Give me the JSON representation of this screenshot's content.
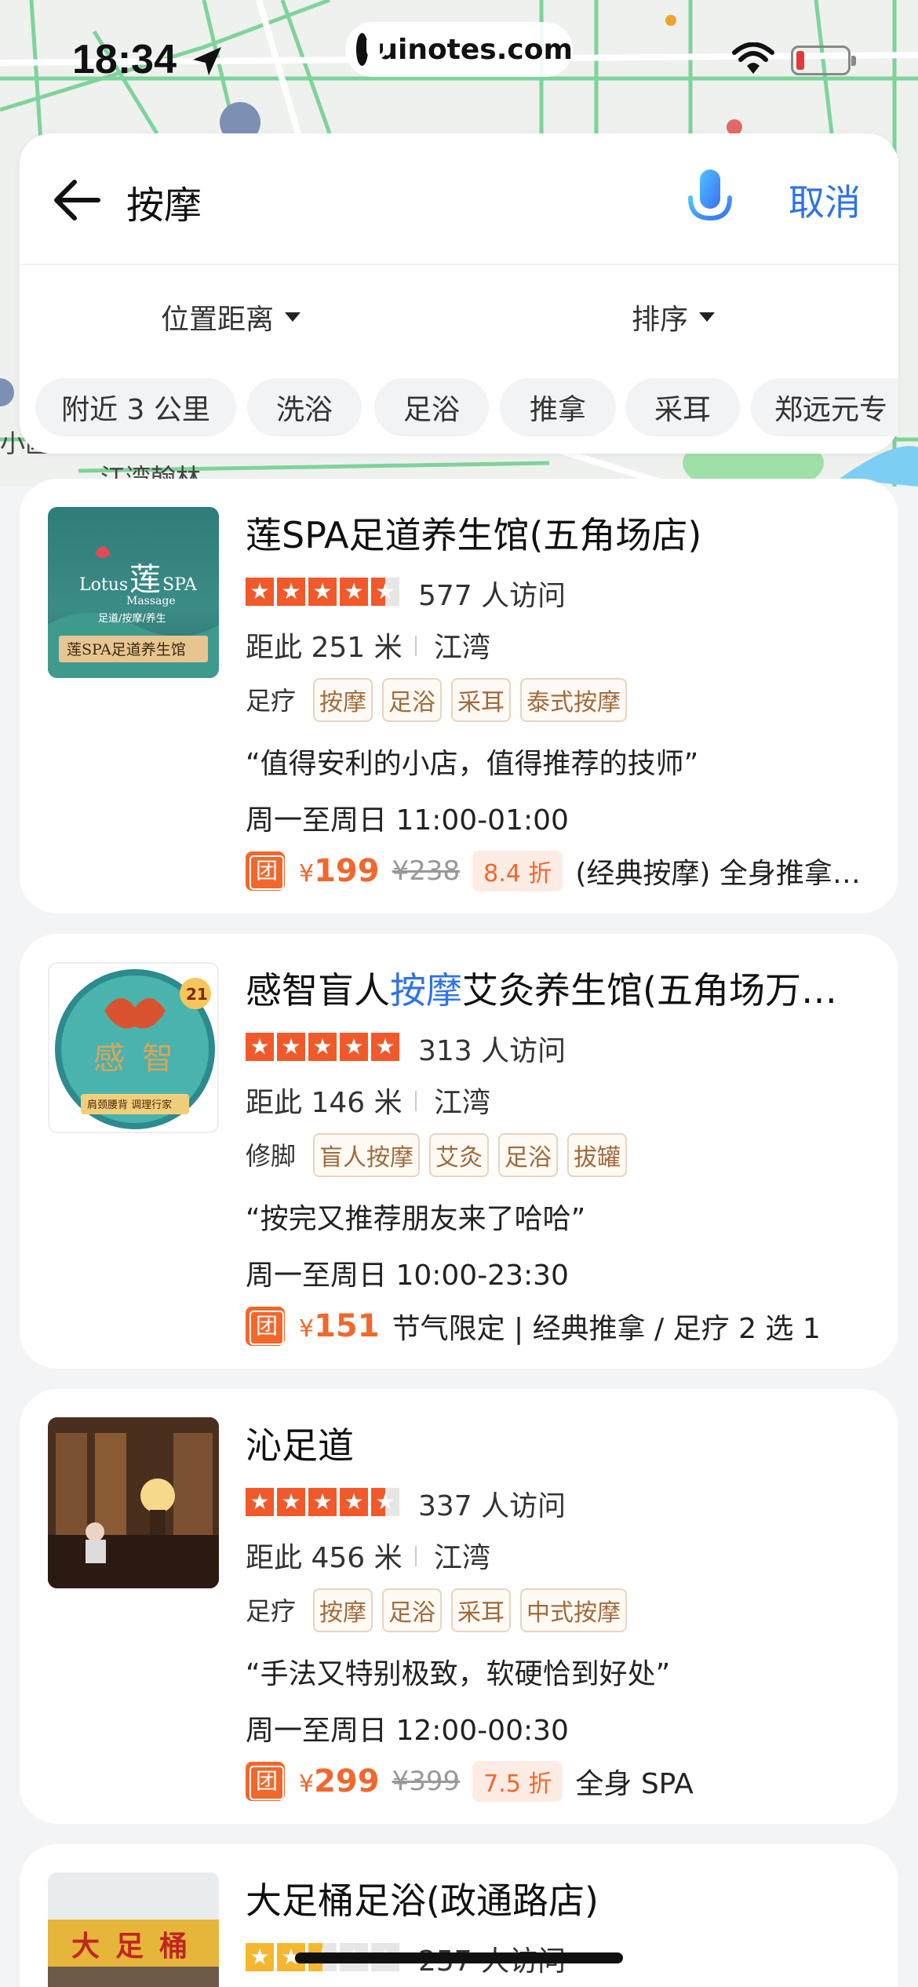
{
  "status_bar": {
    "time": "18:34",
    "url": "uinotes.com",
    "icons": [
      "location-arrow-icon",
      "wifi-icon",
      "battery-icon"
    ]
  },
  "map": {
    "labels": [
      "小区",
      "江湾翰林"
    ]
  },
  "search": {
    "query": "按摩",
    "cancel_label": "取消"
  },
  "filters": {
    "location_label": "位置距离",
    "sort_label": "排序"
  },
  "chips": [
    "附近 3 公里",
    "洗浴",
    "足浴",
    "推拿",
    "采耳",
    "郑远元专"
  ],
  "results": [
    {
      "title": "莲SPA足道养生馆(五角场店)",
      "rating": 4.5,
      "visits": "577 人访问",
      "distance": "距此 251 米",
      "area": "江湾",
      "category": "足疗",
      "tags": [
        "按摩",
        "足浴",
        "采耳",
        "泰式按摩"
      ],
      "quote": "“值得安利的小店，值得推荐的技师”",
      "hours": "周一至周日 11:00-01:00",
      "price": "199",
      "original_price": "¥238",
      "discount": "8.4 折",
      "deal": "(经典按摩) 全身推拿…",
      "thumb_text": [
        "Lotus",
        "莲",
        "SPA",
        "Massage",
        "足道/按摩/养生",
        "莲SPA足道养生馆"
      ]
    },
    {
      "title_parts": [
        "感智盲人",
        "按摩",
        "艾灸养生馆(五角场万…"
      ],
      "rating": 5,
      "visits": "313 人访问",
      "distance": "距此 146 米",
      "area": "江湾",
      "category": "修脚",
      "tags": [
        "盲人按摩",
        "艾灸",
        "足浴",
        "拔罐"
      ],
      "quote": "“按完又推荐朋友来了哈哈”",
      "hours": "周一至周日 10:00-23:30",
      "price": "151",
      "deal": "节气限定 | 经典推拿 / 足疗 2 选 1",
      "thumb_text": [
        "21",
        "感",
        "智",
        "肩颈腰背 调理行家"
      ]
    },
    {
      "title": "沁足道",
      "rating": 4.5,
      "visits": "337 人访问",
      "distance": "距此 456 米",
      "area": "江湾",
      "category": "足疗",
      "tags": [
        "按摩",
        "足浴",
        "采耳",
        "中式按摩"
      ],
      "quote": "“手法又特别极致，软硬恰到好处”",
      "hours": "周一至周日 12:00-00:30",
      "price": "299",
      "original_price": "¥399",
      "discount": "7.5 折",
      "deal": "全身 SPA"
    },
    {
      "title": "大足桶足浴(政通路店)",
      "rating": 2.5,
      "visits": "257 人访问",
      "thumb_text": [
        "大",
        "足",
        "桶"
      ]
    }
  ],
  "currency_symbol": "¥",
  "colors": {
    "accent_blue": "#2e72e8",
    "price_orange": "#f1672c",
    "star_orange": "#f1592a",
    "tag_brown": "#a06a3a"
  }
}
